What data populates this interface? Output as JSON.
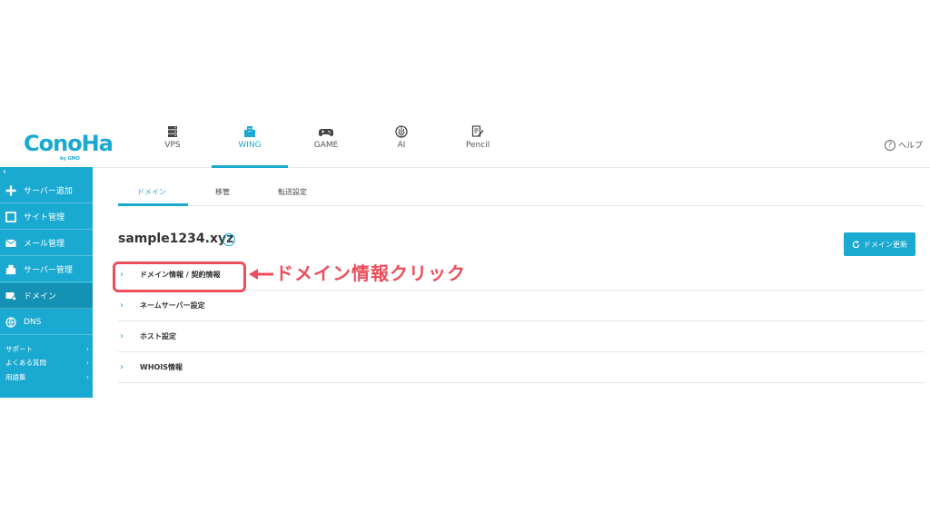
{
  "brand": {
    "logo_text": "ConoHa",
    "logo_sub": "by GMO"
  },
  "nav": [
    {
      "label": "VPS",
      "icon": "server-icon",
      "active": false
    },
    {
      "label": "WING",
      "icon": "building-icon",
      "active": true
    },
    {
      "label": "GAME",
      "icon": "gamepad-icon",
      "active": false
    },
    {
      "label": "AI",
      "icon": "brain-icon",
      "active": false
    },
    {
      "label": "Pencil",
      "icon": "pencil-doc-icon",
      "active": false
    }
  ],
  "help": {
    "label": "ヘルプ"
  },
  "sidebar": {
    "collapse": "‹",
    "items": [
      {
        "label": "サーバー追加",
        "icon": "plus-icon"
      },
      {
        "label": "サイト管理",
        "icon": "square-icon"
      },
      {
        "label": "メール管理",
        "icon": "mail-icon"
      },
      {
        "label": "サーバー管理",
        "icon": "building-icon"
      },
      {
        "label": "ドメイン",
        "icon": "domain-icon",
        "active": true
      },
      {
        "label": "DNS",
        "icon": "globe-icon"
      }
    ],
    "links": [
      {
        "label": "サポート",
        "chevron": "›"
      },
      {
        "label": "よくある質問",
        "chevron": "›"
      },
      {
        "label": "用語集",
        "chevron": "›"
      }
    ]
  },
  "tabs": [
    {
      "label": "ドメイン",
      "active": true
    },
    {
      "label": "移管",
      "active": false
    },
    {
      "label": "転送設定",
      "active": false
    }
  ],
  "domain": {
    "name": "sample1234.xyz",
    "help": "?"
  },
  "renew_button": {
    "label": "ドメイン更新"
  },
  "accordion": [
    {
      "label": "ドメイン情報 / 契約情報",
      "chevron": "›"
    },
    {
      "label": "ネームサーバー設定",
      "chevron": "›"
    },
    {
      "label": "ホスト設定",
      "chevron": "›"
    },
    {
      "label": "WHOIS情報",
      "chevron": "›"
    }
  ],
  "annotation": {
    "text": "ドメイン情報クリック"
  },
  "colors": {
    "accent": "#1aa9d1",
    "accent_dark": "#1491b5",
    "annotation": "#ec4e5c"
  }
}
